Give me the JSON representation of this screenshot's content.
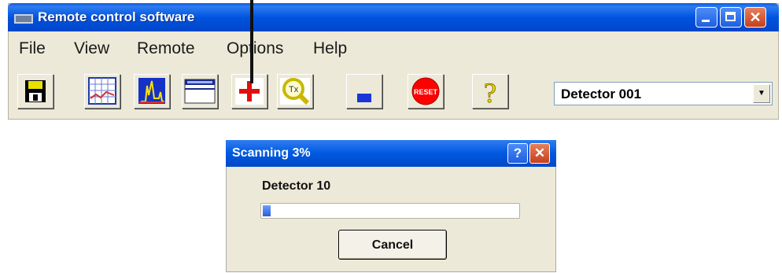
{
  "window": {
    "title": "Remote control software",
    "title_bar_color": "#0053e0"
  },
  "menu": {
    "items": [
      {
        "label": "File"
      },
      {
        "label": "View"
      },
      {
        "label": "Remote"
      },
      {
        "label": "Options"
      },
      {
        "label": "Help"
      }
    ]
  },
  "toolbar": {
    "buttons": [
      {
        "icon": "save-disk-icon"
      },
      {
        "icon": "grid-chart-icon"
      },
      {
        "icon": "spectrum-chart-icon"
      },
      {
        "icon": "table-view-icon"
      },
      {
        "icon": "red-cross-icon"
      },
      {
        "icon": "magnifier-icon"
      },
      {
        "icon": "blue-block-icon"
      },
      {
        "icon": "reset-icon",
        "label": "RESET"
      },
      {
        "icon": "question-mark-icon"
      }
    ],
    "detector_select": {
      "value": "Detector 001"
    }
  },
  "dialog": {
    "title": "Scanning 3%",
    "detector_label": "Detector 10",
    "progress": 0.03,
    "cancel_label": "Cancel"
  }
}
